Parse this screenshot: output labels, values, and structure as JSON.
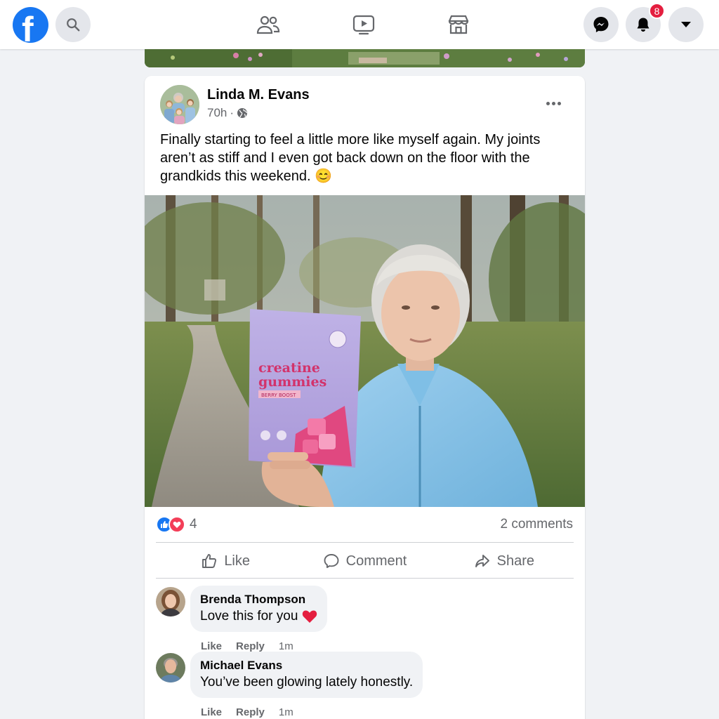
{
  "colors": {
    "brand": "#1877f2",
    "badge": "#e41e3f",
    "secondary_text": "#65676b",
    "page_bg": "#f0f2f5",
    "like_blue": "#1877f2",
    "love_red": "#f33e58"
  },
  "topbar": {
    "logo_letter": "f",
    "icons": {
      "search": "search-icon",
      "friends": "friends-icon",
      "watch": "video-icon",
      "marketplace": "marketplace-icon",
      "messenger": "messenger-icon",
      "notifications": "bell-icon",
      "account": "caret-down-icon"
    },
    "notification_count": "8"
  },
  "post": {
    "author": "Linda M. Evans",
    "time": "70h",
    "separator": "·",
    "privacy_icon": "globe-icon",
    "text": "Finally starting to feel a little more like myself again. My joints aren’t as stiff and I even got back down on the floor with the grandkids this weekend. 😊",
    "photo": {
      "product_line1": "creatine",
      "product_line2": "gummies",
      "product_tag": "BERRY BOOST"
    },
    "reaction_count": "4",
    "comments_count": "2 comments",
    "actions": {
      "like": "Like",
      "comment": "Comment",
      "share": "Share"
    }
  },
  "comments": [
    {
      "name": "Brenda Thompson",
      "text": "Love this for you",
      "emoji": "❤️",
      "like": "Like",
      "reply": "Reply",
      "time": "1m"
    },
    {
      "name": "Michael Evans",
      "text": "You’ve been glowing lately honestly.",
      "like": "Like",
      "reply": "Reply",
      "time": "1m"
    }
  ]
}
